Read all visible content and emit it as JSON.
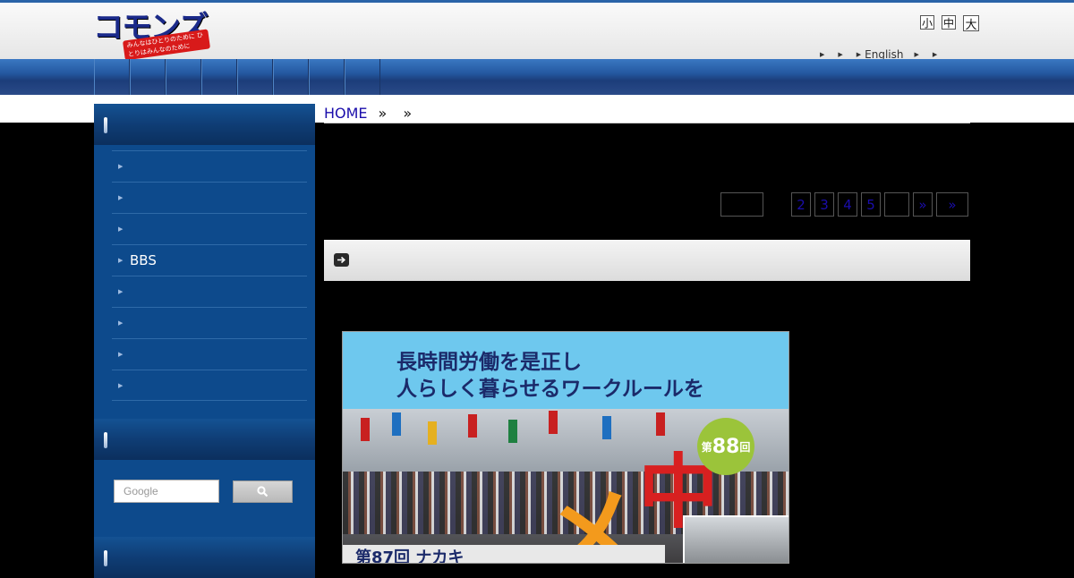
{
  "header": {
    "logo_text": "コモンズ",
    "logo_ribbon": "みんなはひとりのために ひとりはみんなのために",
    "size_small": "小",
    "size_medium": "中",
    "size_large": "大",
    "lang_link": "English",
    "accent_color": "#2a64a8"
  },
  "navbar": {
    "item_count": 8
  },
  "breadcrumb": {
    "home": "HOME",
    "sep1": "»",
    "sep2": "»"
  },
  "pagination": {
    "pages": [
      "",
      "2",
      "3",
      "4",
      "5",
      "",
      "»",
      "»"
    ]
  },
  "sidebar": {
    "menu_items": [
      "",
      "",
      "",
      "BBS",
      "",
      "",
      "",
      ""
    ],
    "search_placeholder": "Google",
    "search_button_icon": "search-icon"
  },
  "poster": {
    "line1": "長時間労働を是正し",
    "line2": "人らしく暮らせるワークルールを",
    "badge_small": "第",
    "badge_num": "88",
    "badge_small2": "回",
    "big_char1": "メ",
    "big_char2": "中",
    "bottom_text": "第87回 ナカキ"
  }
}
